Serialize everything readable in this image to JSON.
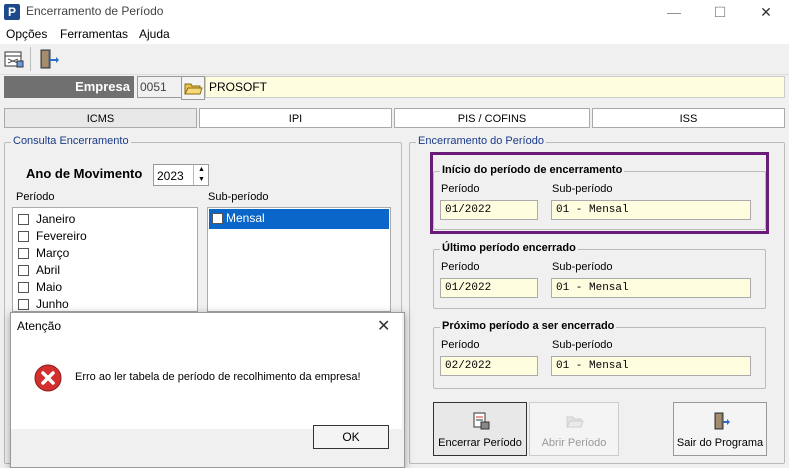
{
  "window": {
    "title": "Encerramento de Período",
    "minimize": "—",
    "maximize": "☐",
    "close": "✕",
    "app_icon": "P"
  },
  "menu": [
    "Opções",
    "Ferramentas",
    "Ajuda"
  ],
  "empresa": {
    "label": "Empresa",
    "code": "0051",
    "name": "PROSOFT"
  },
  "tabs": [
    "ICMS",
    "IPI",
    "PIS / COFINS",
    "ISS"
  ],
  "consulta": {
    "legend": "Consulta Encerramento",
    "ano_label": "Ano de Movimento",
    "ano_value": "2023",
    "periodo_label": "Período",
    "subperiodo_label": "Sub-período",
    "periods": [
      "Janeiro",
      "Fevereiro",
      "Março",
      "Abril",
      "Maio",
      "Junho"
    ],
    "subperiods": [
      "Mensal"
    ]
  },
  "encerramento": {
    "legend": "Encerramento do Período",
    "inicio": {
      "title": "Início do período de encerramento",
      "periodo_label": "Período",
      "sub_label": "Sub-período",
      "periodo": "01/2022",
      "sub": "01 - Mensal"
    },
    "ultimo": {
      "title": "Último período encerrado",
      "periodo_label": "Período",
      "sub_label": "Sub-período",
      "periodo": "01/2022",
      "sub": "01 - Mensal"
    },
    "proximo": {
      "title": "Próximo período a ser encerrado",
      "periodo_label": "Período",
      "sub_label": "Sub-período",
      "periodo": "02/2022",
      "sub": "01 - Mensal"
    },
    "highlight_color": "#6a1b7a"
  },
  "buttons": {
    "encerrar": "Encerrar Período",
    "abrir": "Abrir Período",
    "sair": "Sair do Programa"
  },
  "dialog": {
    "title": "Atenção",
    "message": "Erro ao ler tabela de período de recolhimento da empresa!",
    "ok": "OK",
    "icon": "error-icon"
  }
}
